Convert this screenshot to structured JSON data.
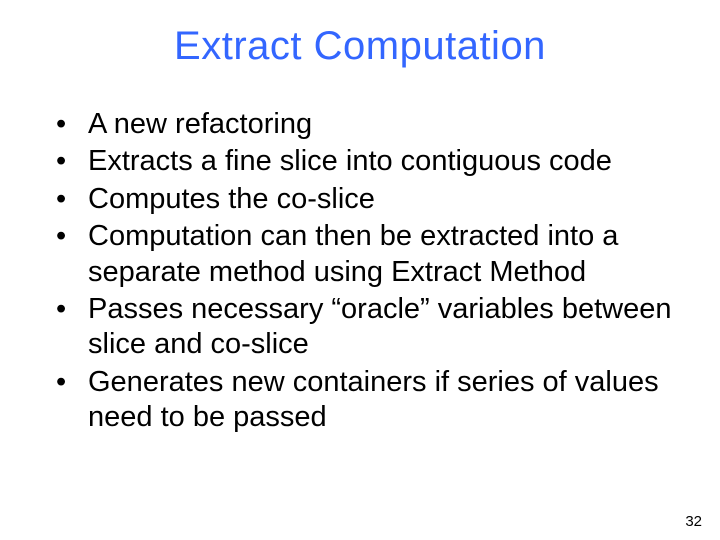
{
  "title": "Extract Computation",
  "bullets": [
    "A new refactoring",
    "Extracts a fine slice into contiguous code",
    "Computes the co-slice",
    "Computation can then be extracted into a separate method using Extract Method",
    "Passes necessary “oracle” variables between slice and co-slice",
    "Generates new containers if series of values need to be passed"
  ],
  "page_number": "32"
}
